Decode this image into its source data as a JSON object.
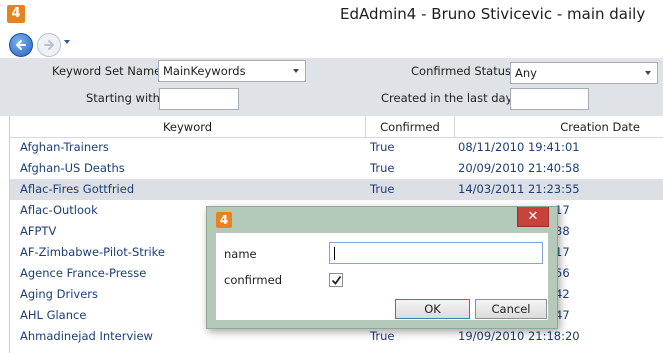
{
  "window": {
    "title": "EdAdmin4 - Bruno Stivicevic - main daily",
    "icon_text": "4"
  },
  "nav": {
    "back_icon": "arrow-left-icon",
    "forward_icon": "arrow-right-icon"
  },
  "filters": {
    "keyword_set_label": "Keyword Set Name:",
    "keyword_set_value": "MainKeywords",
    "confirmed_status_label": "Confirmed Status:",
    "confirmed_status_value": "Any",
    "starting_with_label": "Starting with:",
    "starting_with_value": "",
    "created_label": "Created in the last days",
    "created_value": ""
  },
  "grid": {
    "columns": [
      "Keyword",
      "Confirmed",
      "Creation Date"
    ],
    "rows": [
      {
        "keyword": "Afghan-Trainers",
        "confirmed": "True",
        "date": "08/11/2010 19:41:01"
      },
      {
        "keyword": "Afghan-US Deaths",
        "confirmed": "True",
        "date": "20/09/2010 21:40:58"
      },
      {
        "keyword": "Aflac-Fires Gottfried",
        "confirmed": "True",
        "date": "14/03/2011 21:23:55",
        "selected": true
      },
      {
        "keyword": "Aflac-Outlook",
        "confirmed": "",
        "date": "17"
      },
      {
        "keyword": "AFPTV",
        "confirmed": "",
        "date": "38"
      },
      {
        "keyword": "AF-Zimbabwe-Pilot-Strike",
        "confirmed": "",
        "date": "17"
      },
      {
        "keyword": "Agence France-Presse",
        "confirmed": "",
        "date": "56"
      },
      {
        "keyword": "Aging Drivers",
        "confirmed": "",
        "date": "42"
      },
      {
        "keyword": "AHL Glance",
        "confirmed": "",
        "date": "47"
      },
      {
        "keyword": "Ahmadinejad Interview",
        "confirmed": "True",
        "date": "19/09/2010 21:18:20"
      }
    ]
  },
  "dialog": {
    "icon_text": "4",
    "close_label": "✕",
    "name_label": "name",
    "name_value": "",
    "confirmed_label": "confirmed",
    "confirmed_checked": true,
    "ok_label": "OK",
    "cancel_label": "Cancel"
  }
}
